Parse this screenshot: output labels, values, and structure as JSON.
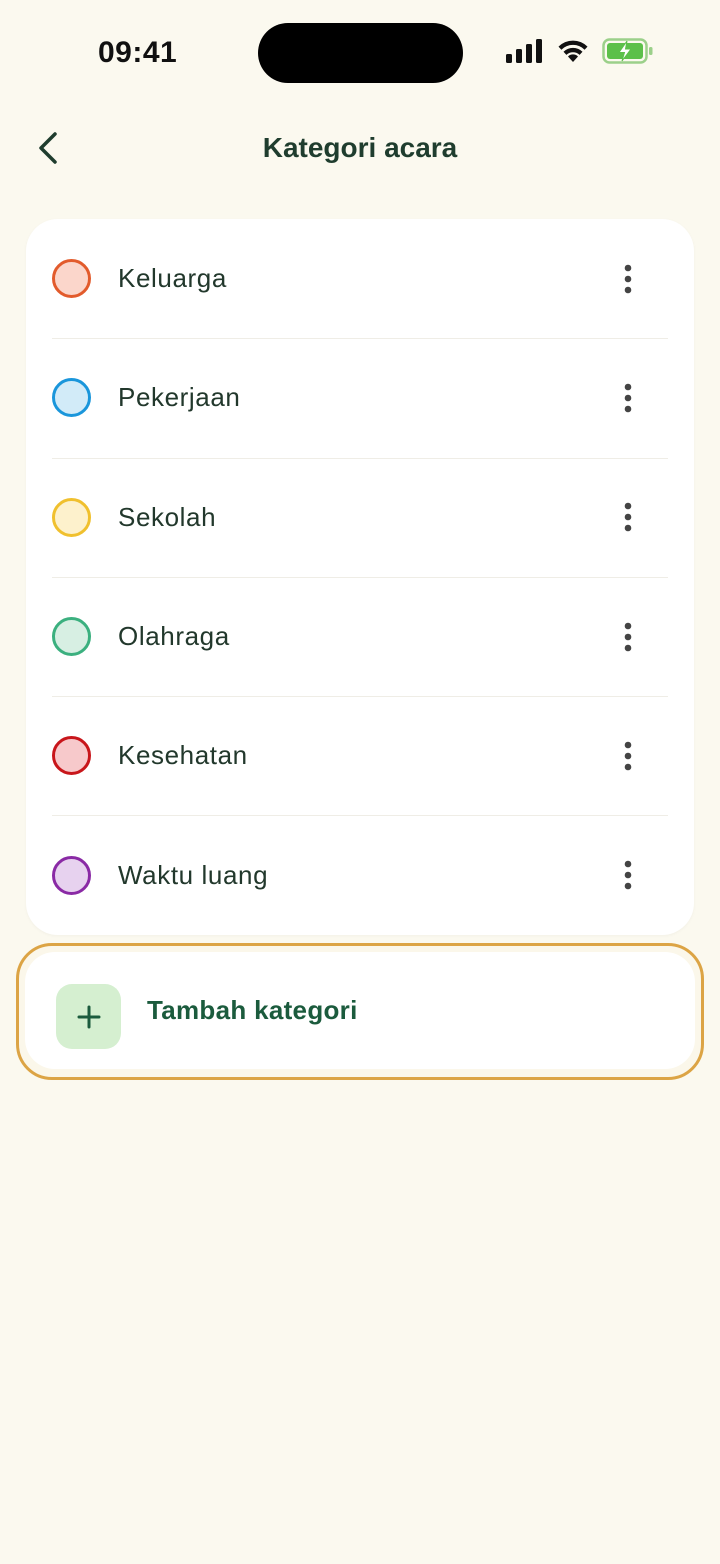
{
  "status_bar": {
    "time": "09:41",
    "icons": [
      "signal-icon",
      "wifi-icon",
      "battery-charging-icon"
    ]
  },
  "header": {
    "title": "Kategori acara",
    "back_icon": "chevron-left-icon"
  },
  "categories": [
    {
      "label": "Keluarga",
      "border_color": "#e25b2c",
      "fill_color": "#fbd6cb"
    },
    {
      "label": "Pekerjaan",
      "border_color": "#1a96db",
      "fill_color": "#d2ebf8"
    },
    {
      "label": "Sekolah",
      "border_color": "#f0c02e",
      "fill_color": "#fdf1cc"
    },
    {
      "label": "Olahraga",
      "border_color": "#3bb07f",
      "fill_color": "#d7efe3"
    },
    {
      "label": "Kesehatan",
      "border_color": "#c8161b",
      "fill_color": "#f7c9cb"
    },
    {
      "label": "Waktu luang",
      "border_color": "#8a2aa5",
      "fill_color": "#e7d2ef"
    }
  ],
  "add_category": {
    "label": "Tambah kategori",
    "icon": "plus-icon",
    "highlight_color": "#dca445"
  },
  "colors": {
    "background": "#fbf9ef",
    "card": "#ffffff",
    "text": "#1f3d2e",
    "accent_green": "#1b5b3d"
  }
}
